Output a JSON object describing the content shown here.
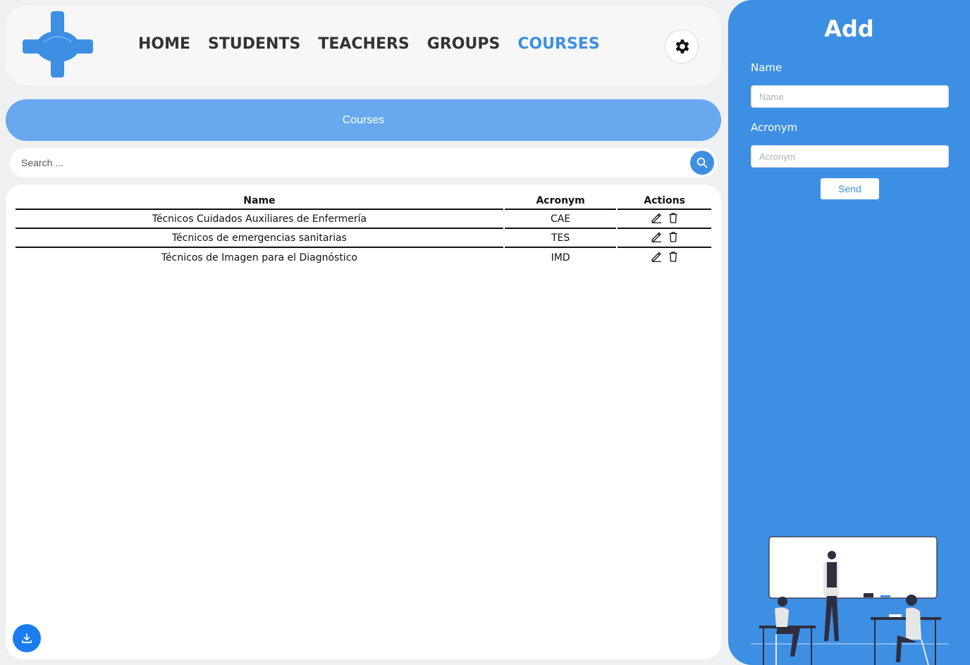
{
  "nav": {
    "items": [
      {
        "label": "HOME",
        "active": false
      },
      {
        "label": "STUDENTS",
        "active": false
      },
      {
        "label": "TEACHERS",
        "active": false
      },
      {
        "label": "GROUPS",
        "active": false
      },
      {
        "label": "COURSES",
        "active": true
      }
    ]
  },
  "banner": {
    "title": "Courses"
  },
  "search": {
    "placeholder": "Search ..."
  },
  "table": {
    "headers": [
      "Name",
      "Acronym",
      "Actions"
    ],
    "rows": [
      {
        "name": "Técnicos Cuidados Auxiliares de Enfermería",
        "acronym": "CAE"
      },
      {
        "name": "Técnicos de emergencias sanitarias",
        "acronym": "TES"
      },
      {
        "name": "Técnicos de Imagen para el Diagnóstico",
        "acronym": "IMD"
      }
    ]
  },
  "sidebar": {
    "title": "Add",
    "name_label": "Name",
    "name_placeholder": "Name",
    "acronym_label": "Acronym",
    "acronym_placeholder": "Acronym",
    "send_label": "Send"
  },
  "icons": {
    "logo": "medical-cross-logo",
    "settings": "gear-icon",
    "search": "search-icon",
    "edit": "pencil-icon",
    "delete": "trash-icon",
    "download": "download-icon"
  },
  "colors": {
    "accent": "#3d8fe3",
    "banner": "#67a8ef",
    "active_nav": "#3d8fe3"
  }
}
